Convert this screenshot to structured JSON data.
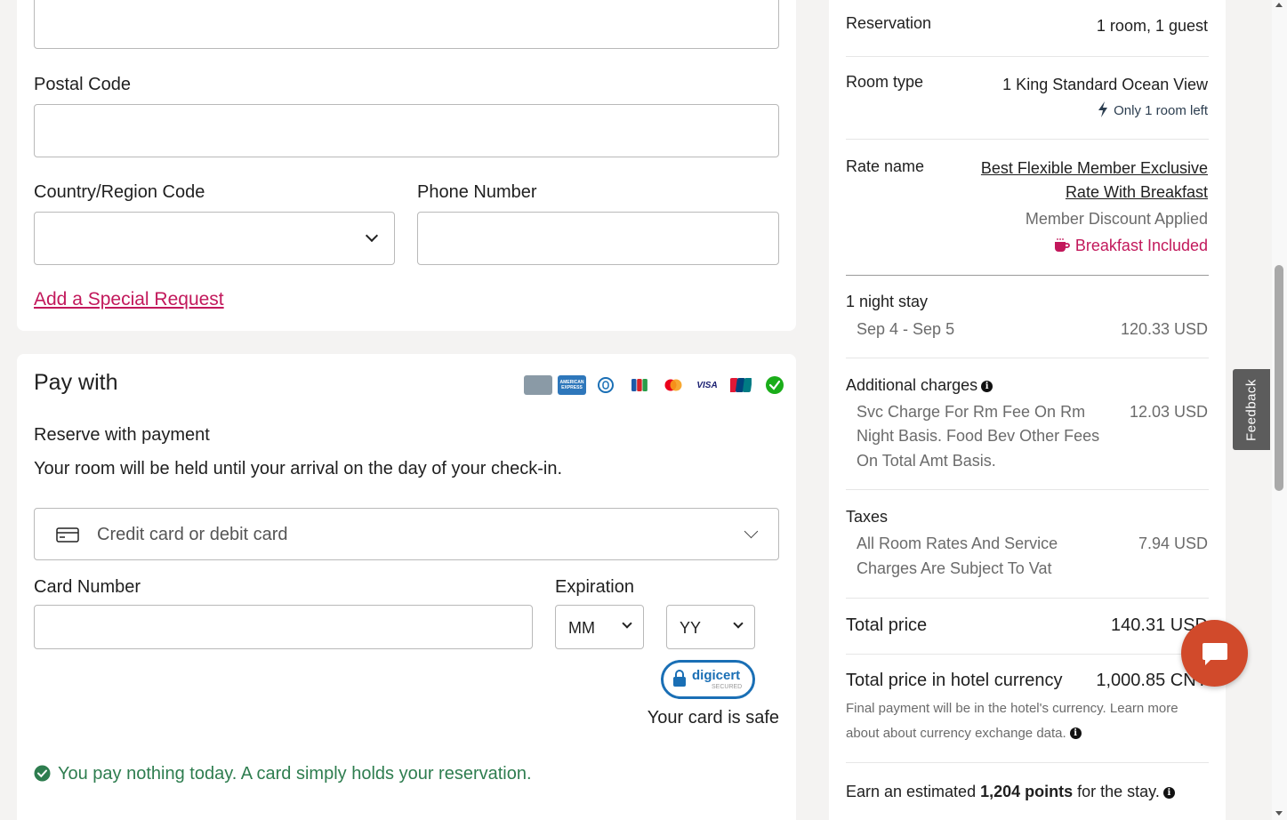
{
  "form": {
    "postal_code_label": "Postal Code",
    "country_code_label": "Country/Region Code",
    "country_code_value": "",
    "phone_label": "Phone Number",
    "special_request_link": "Add a Special Request"
  },
  "payment": {
    "title": "Pay with",
    "reserve_heading": "Reserve with payment",
    "reserve_desc": "Your room will be held until your arrival on the day of your check-in.",
    "method_value": "Credit card or debit card",
    "card_number_label": "Card Number",
    "expiration_label": "Expiration",
    "month_value": "MM",
    "year_value": "YY",
    "digicert_label": "digicert",
    "digicert_sub": "SECURED",
    "card_safe_text": "Your card is safe",
    "pay_nothing_text": "You pay nothing today. A card simply holds your reservation.",
    "logos": [
      {
        "name": "generic-card-logo",
        "color": "#8a9aa6",
        "text": ""
      },
      {
        "name": "amex-logo",
        "color": "#2e77bb",
        "text": "AMERICAN EXPRESS"
      },
      {
        "name": "diners-logo",
        "color": "#ffffff",
        "text": ""
      },
      {
        "name": "jcb-logo",
        "color": "#ffffff",
        "text": ""
      },
      {
        "name": "mastercard-logo",
        "color": "#ffffff",
        "text": ""
      },
      {
        "name": "visa-logo",
        "color": "#ffffff",
        "text": "VISA"
      },
      {
        "name": "unionpay-logo",
        "color": "#ffffff",
        "text": ""
      },
      {
        "name": "wechat-pay-logo",
        "color": "#ffffff",
        "text": ""
      }
    ]
  },
  "summary": {
    "reservation_label": "Reservation",
    "reservation_value": "1 room, 1 guest",
    "room_type_label": "Room type",
    "room_type_value": "1 King Standard Ocean View",
    "room_left": "Only 1 room left",
    "rate_name_label": "Rate name",
    "rate_name_line1": "Best Flexible Member Exclusive",
    "rate_name_line2": "Rate With Breakfast",
    "member_discount": "Member Discount Applied",
    "breakfast": "Breakfast Included",
    "stay_label": "1 night stay",
    "stay_dates": "Sep 4 - Sep 5",
    "stay_price": "120.33 USD",
    "additional_label": "Additional charges",
    "additional_desc_1": "Svc Charge For Rm Fee On Rm",
    "additional_desc_2": "Night Basis. Food Bev Other Fees",
    "additional_desc_3": "On Total Amt Basis.",
    "additional_price": "12.03 USD",
    "taxes_label": "Taxes",
    "taxes_desc_1": "All Room Rates And Service",
    "taxes_desc_2": "Charges Are Subject To Vat",
    "taxes_price": "7.94 USD",
    "total_label": "Total price",
    "total_value": "140.31 USD",
    "hotel_currency_label": "Total price in hotel currency",
    "hotel_currency_value": "1,000.85 CNY",
    "currency_note_1": "Final payment will be in the hotel's currency. Learn more",
    "currency_note_2": "about about currency exchange data.",
    "earn_prefix": "Earn an estimated ",
    "earn_points": "1,204 points",
    "earn_suffix": " for the stay."
  },
  "widgets": {
    "feedback_label": "Feedback"
  },
  "colors": {
    "accent_pink": "#c2185b",
    "success_green": "#2e7d4f",
    "chat_orange": "#d14a2b"
  }
}
